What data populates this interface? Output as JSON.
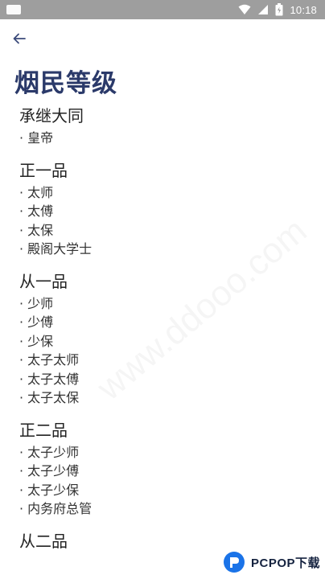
{
  "status_bar": {
    "time": "10:18"
  },
  "header": {
    "back_icon": "back-arrow-icon",
    "title": "烟民等级"
  },
  "ranks": [
    {
      "heading": "承继大同",
      "items": [
        "皇帝"
      ]
    },
    {
      "heading": "正一品",
      "items": [
        "太师",
        "太傅",
        "太保",
        "殿阁大学士"
      ]
    },
    {
      "heading": "从一品",
      "items": [
        "少师",
        "少傅",
        "少保",
        "太子太师",
        "太子太傅",
        "太子太保"
      ]
    },
    {
      "heading": "正二品",
      "items": [
        "太子少师",
        "太子少傅",
        "太子少保",
        "内务府总管"
      ]
    },
    {
      "heading": "从二品",
      "items": []
    }
  ],
  "watermark": {
    "text": "www.ddooo.com"
  },
  "badge": {
    "text": "PCPOP下载"
  },
  "colors": {
    "title": "#2b3a6a",
    "status_bar": "#9e9e9e",
    "accent": "#1a73e8"
  }
}
